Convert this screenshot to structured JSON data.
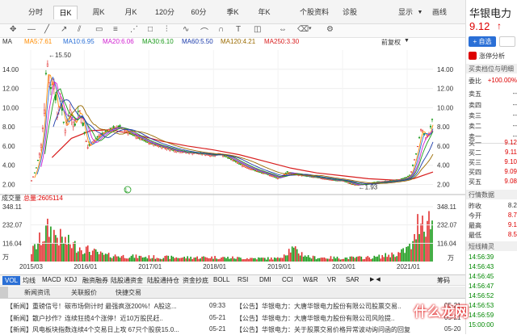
{
  "tabs": [
    "分时",
    "日K",
    "周K",
    "月K",
    "120分",
    "60分",
    "季K",
    "年K",
    "个股资料",
    "诊股",
    "显示",
    "画线"
  ],
  "tab_dropdown": "▼",
  "ma_legend": [
    {
      "label": "MA",
      "color": "#333"
    },
    {
      "label": "MA5:7.61",
      "color": "#ff8c00"
    },
    {
      "label": "MA10:6.95",
      "color": "#2a6fd6"
    },
    {
      "label": "MA20:6.06",
      "color": "#d020d0"
    },
    {
      "label": "MA30:6.10",
      "color": "#1a9a1a"
    },
    {
      "label": "MA60:5.50",
      "color": "#1a3aaa"
    },
    {
      "label": "MA120:4.21",
      "color": "#9a6a00"
    },
    {
      "label": "MA250:3.30",
      "color": "#d81e1e"
    }
  ],
  "adjust_label": "前复权",
  "adjust_arrow": "▼",
  "volume_legend": {
    "label": "成交量",
    "total": "总量:2605114"
  },
  "annotations": {
    "high": "←15.50",
    "low": "←1.93",
    "marker_L": "L"
  },
  "volume_unit": "万",
  "indicator_tabs": [
    "VOL",
    "均线",
    "MACD",
    "KDJ",
    "融资融券",
    "陆股通资金",
    "陆股通持仓",
    "资金抄底",
    "BOLL",
    "RSI",
    "DMI",
    "CCI",
    "W&R",
    "VR",
    "SAR"
  ],
  "indicator_nav": {
    "arrows": "▶ ◀",
    "chips": "筹码"
  },
  "news_tabs": [
    "新闻资讯",
    "关联报价",
    "快捷交易"
  ],
  "news_left": [
    {
      "text": "【新闻】重磅信号！碳市场倒计时 最强疯涨200%！A股这...",
      "time": "09:33"
    },
    {
      "text": "【新闻】散户抄作？连续狂揽4个涨停！近10万股民赶..",
      "time": "05-21"
    },
    {
      "text": "【新闻】风电板块指数连续4个交易日上攻 67只个股获15.0...",
      "time": "05-21"
    }
  ],
  "news_right": [
    {
      "text": "【公告】华银电力：大唐华银电力股份有限公司股票交易..",
      "time": "05-21"
    },
    {
      "text": "【公告】华银电力：大唐华银电力股份有限公司风险提..",
      "time": "05-21"
    },
    {
      "text": "【公告】华银电力：关于股票交易价格异常波动询问函的回复",
      "time": "05-20"
    }
  ],
  "stock": {
    "name": "华银电力",
    "price": "9.12",
    "arrow": "↑",
    "add_btn": "+ 自选",
    "limit_up_btn": "涨停分析"
  },
  "order_book": {
    "title": "买卖档位与明细",
    "ratio_label": "委比",
    "ratio_value": "+100.00%",
    "sells": [
      {
        "l": "卖五",
        "v": "--"
      },
      {
        "l": "卖四",
        "v": "--"
      },
      {
        "l": "卖三",
        "v": "--"
      },
      {
        "l": "卖二",
        "v": "--"
      },
      {
        "l": "卖一",
        "v": "--"
      }
    ],
    "buys": [
      {
        "l": "买一",
        "v": "9.12"
      },
      {
        "l": "买二",
        "v": "9.11"
      },
      {
        "l": "买三",
        "v": "9.10"
      },
      {
        "l": "买四",
        "v": "9.09"
      },
      {
        "l": "买五",
        "v": "9.08"
      }
    ]
  },
  "quote": {
    "title": "行情数据",
    "items": [
      {
        "l": "昨收",
        "v": "8.2"
      },
      {
        "l": "今开",
        "v": "8.7"
      },
      {
        "l": "最高",
        "v": "9.1"
      },
      {
        "l": "最低",
        "v": "8.5"
      }
    ]
  },
  "ticks": {
    "title": "短线精灵",
    "times": [
      "14:56:39",
      "14:56:43",
      "14:56:45",
      "14:56:47",
      "14:56:52",
      "14:56:53",
      "14:56:59",
      "15:00:00"
    ]
  },
  "watermark": "什么龙网",
  "chart_data": {
    "type": "candlestick",
    "price_axis": {
      "ticks": [
        2.0,
        4.0,
        6.0,
        8.0,
        10.0,
        12.0,
        14.0
      ],
      "tick_labels": [
        "2.00",
        "4.00",
        "6.00",
        "8.00",
        "10.00",
        "12.00",
        "14.00"
      ],
      "ylim": [
        1.2,
        16.0
      ]
    },
    "volume_axis": {
      "ticks": [
        116.04,
        232.07,
        348.11
      ],
      "tick_labels": [
        "116.04",
        "232.07",
        "348.11"
      ],
      "ylim": [
        0,
        348.11
      ]
    },
    "x_labels": [
      "2015/03",
      "2016/01",
      "2017/01",
      "2018/01",
      "2019/01",
      "2020/01",
      "2021/01"
    ],
    "x_label_dates": [
      2015.17,
      2016.0,
      2017.0,
      2018.0,
      2019.0,
      2020.0,
      2021.0
    ],
    "x_range": [
      2015.17,
      2021.4
    ],
    "close_path": [
      [
        2015.17,
        2.2
      ],
      [
        2015.25,
        3.5
      ],
      [
        2015.33,
        6.0
      ],
      [
        2015.38,
        9.5
      ],
      [
        2015.42,
        15.5
      ],
      [
        2015.47,
        11.5
      ],
      [
        2015.52,
        13.5
      ],
      [
        2015.58,
        9.0
      ],
      [
        2015.63,
        11.0
      ],
      [
        2015.7,
        7.5
      ],
      [
        2015.78,
        9.8
      ],
      [
        2015.85,
        8.0
      ],
      [
        2015.92,
        10.0
      ],
      [
        2016.0,
        7.5
      ],
      [
        2016.05,
        5.8
      ],
      [
        2016.12,
        6.4
      ],
      [
        2016.25,
        7.2
      ],
      [
        2016.4,
        7.8
      ],
      [
        2016.55,
        8.0
      ],
      [
        2016.7,
        7.3
      ],
      [
        2016.85,
        6.8
      ],
      [
        2017.0,
        6.3
      ],
      [
        2017.2,
        5.9
      ],
      [
        2017.4,
        5.5
      ],
      [
        2017.6,
        5.3
      ],
      [
        2017.8,
        5.2
      ],
      [
        2018.0,
        5.0
      ],
      [
        2018.1,
        5.2
      ],
      [
        2018.3,
        4.5
      ],
      [
        2018.5,
        3.8
      ],
      [
        2018.7,
        3.3
      ],
      [
        2018.9,
        2.9
      ],
      [
        2019.0,
        2.6
      ],
      [
        2019.15,
        3.3
      ],
      [
        2019.3,
        3.0
      ],
      [
        2019.5,
        2.8
      ],
      [
        2019.7,
        2.6
      ],
      [
        2019.9,
        2.4
      ],
      [
        2020.0,
        2.4
      ],
      [
        2020.15,
        2.0
      ],
      [
        2020.22,
        1.93
      ],
      [
        2020.4,
        2.1
      ],
      [
        2020.6,
        2.3
      ],
      [
        2020.8,
        2.4
      ],
      [
        2020.95,
        2.6
      ],
      [
        2021.05,
        3.0
      ],
      [
        2021.15,
        5.5
      ],
      [
        2021.22,
        8.0
      ],
      [
        2021.28,
        6.8
      ],
      [
        2021.34,
        7.3
      ],
      [
        2021.4,
        9.12
      ]
    ],
    "ma250_path": [
      [
        2015.5,
        4.8
      ],
      [
        2015.8,
        6.8
      ],
      [
        2016.1,
        7.6
      ],
      [
        2016.4,
        7.7
      ],
      [
        2016.8,
        7.2
      ],
      [
        2017.2,
        6.5
      ],
      [
        2017.6,
        6.0
      ],
      [
        2018.0,
        5.6
      ],
      [
        2018.4,
        5.1
      ],
      [
        2018.8,
        4.4
      ],
      [
        2019.2,
        3.7
      ],
      [
        2019.6,
        3.2
      ],
      [
        2020.0,
        2.9
      ],
      [
        2020.4,
        2.6
      ],
      [
        2020.8,
        2.45
      ],
      [
        2021.1,
        2.6
      ],
      [
        2021.4,
        3.3
      ]
    ],
    "volume_profile": [
      [
        2015.17,
        60
      ],
      [
        2015.3,
        140
      ],
      [
        2015.45,
        230
      ],
      [
        2015.6,
        170
      ],
      [
        2015.8,
        120
      ],
      [
        2016.0,
        90
      ],
      [
        2016.3,
        45
      ],
      [
        2016.6,
        38
      ],
      [
        2017.0,
        32
      ],
      [
        2017.5,
        28
      ],
      [
        2018.0,
        30
      ],
      [
        2018.5,
        24
      ],
      [
        2019.0,
        22
      ],
      [
        2019.2,
        90
      ],
      [
        2019.5,
        30
      ],
      [
        2020.0,
        25
      ],
      [
        2020.5,
        30
      ],
      [
        2020.9,
        60
      ],
      [
        2021.1,
        120
      ],
      [
        2021.2,
        340
      ],
      [
        2021.3,
        280
      ],
      [
        2021.4,
        300
      ]
    ],
    "high_annotation": {
      "date": 2015.42,
      "value": 15.5
    },
    "low_annotation": {
      "date": 2020.22,
      "value": 1.93
    }
  }
}
